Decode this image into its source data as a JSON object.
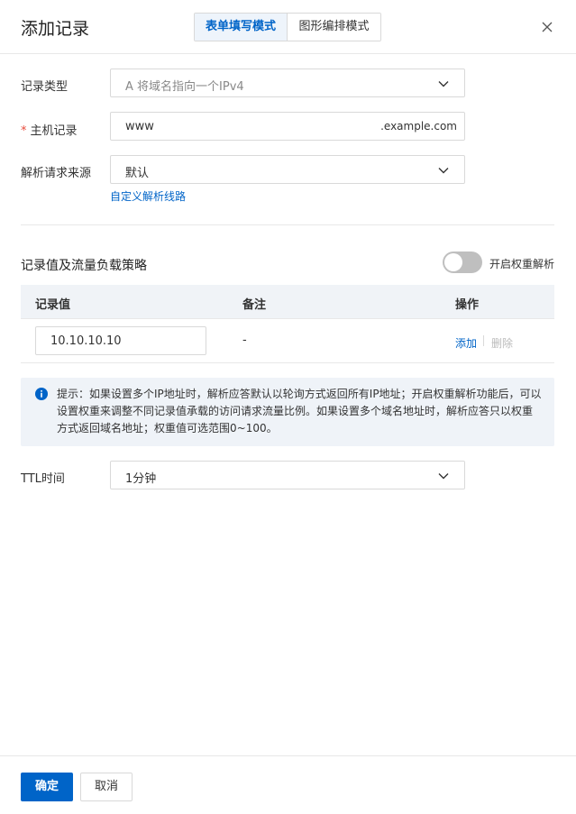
{
  "header": {
    "title": "添加记录",
    "tabs": [
      {
        "label": "表单填写模式",
        "active": true
      },
      {
        "label": "图形编排模式",
        "active": false
      }
    ]
  },
  "form": {
    "record_type": {
      "label": "记录类型",
      "value": "A 将域名指向一个IPv4"
    },
    "host_record": {
      "required_mark": "*",
      "label": "主机记录",
      "value": "www",
      "suffix": ".example.com"
    },
    "resolution_source": {
      "label": "解析请求来源",
      "value": "默认",
      "custom_link": "自定义解析线路"
    }
  },
  "records": {
    "section_title": "记录值及流量负载策略",
    "weight_toggle": {
      "label": "开启权重解析",
      "enabled": false
    },
    "columns": [
      "记录值",
      "备注",
      "操作"
    ],
    "rows": [
      {
        "value": "10.10.10.10",
        "remark": "-",
        "add": "添加",
        "delete": "删除"
      }
    ]
  },
  "tip": {
    "lines": [
      "提示：如果设置多个IP地址时，解析应答默认以轮询方式返回所有IP地址；开启权重解析功能后，可以",
      "设置权重来调整不同记录值承载的访问请求流量比例。如果设置多个域名地址时，解析应答只以权重",
      "方式返回域名地址；权重值可选范围0~100。"
    ]
  },
  "ttl": {
    "label": "TTL时间",
    "value": "1分钟"
  },
  "footer": {
    "confirm": "确定",
    "cancel": "取消"
  },
  "colors": {
    "primary": "#0064c8",
    "required": "#e84c3d"
  },
  "icons": [
    "close-icon",
    "chevron-down-icon",
    "info-icon"
  ]
}
